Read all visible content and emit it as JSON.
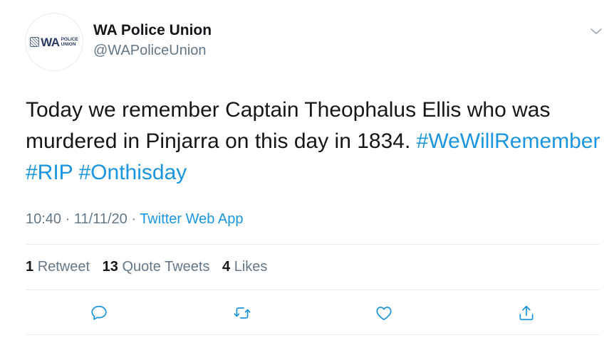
{
  "author": {
    "name": "WA Police Union",
    "handle": "@WAPoliceUnion",
    "avatar_logo": {
      "main": "WA",
      "line1": "POLICE",
      "line2": "UNION"
    }
  },
  "tweet": {
    "text": "Today we remember Captain Theophalus Ellis who was murdered in Pinjarra on this day in 1834.",
    "hashtags": [
      "#WeWillRemember",
      "#RIP",
      "#Onthisday"
    ]
  },
  "meta": {
    "time": "10:40",
    "date": "11/11/20",
    "separator": "·",
    "source": "Twitter Web App"
  },
  "stats": {
    "retweets": {
      "count": "1",
      "label": "Retweet"
    },
    "quote_tweets": {
      "count": "13",
      "label": "Quote Tweets"
    },
    "likes": {
      "count": "4",
      "label": "Likes"
    }
  },
  "actions": [
    "reply-icon",
    "retweet-icon",
    "like-icon",
    "share-icon"
  ],
  "colors": {
    "link": "#1b95e0",
    "secondary": "#657786",
    "primary": "#14171a",
    "divider": "#e6ecf0"
  }
}
